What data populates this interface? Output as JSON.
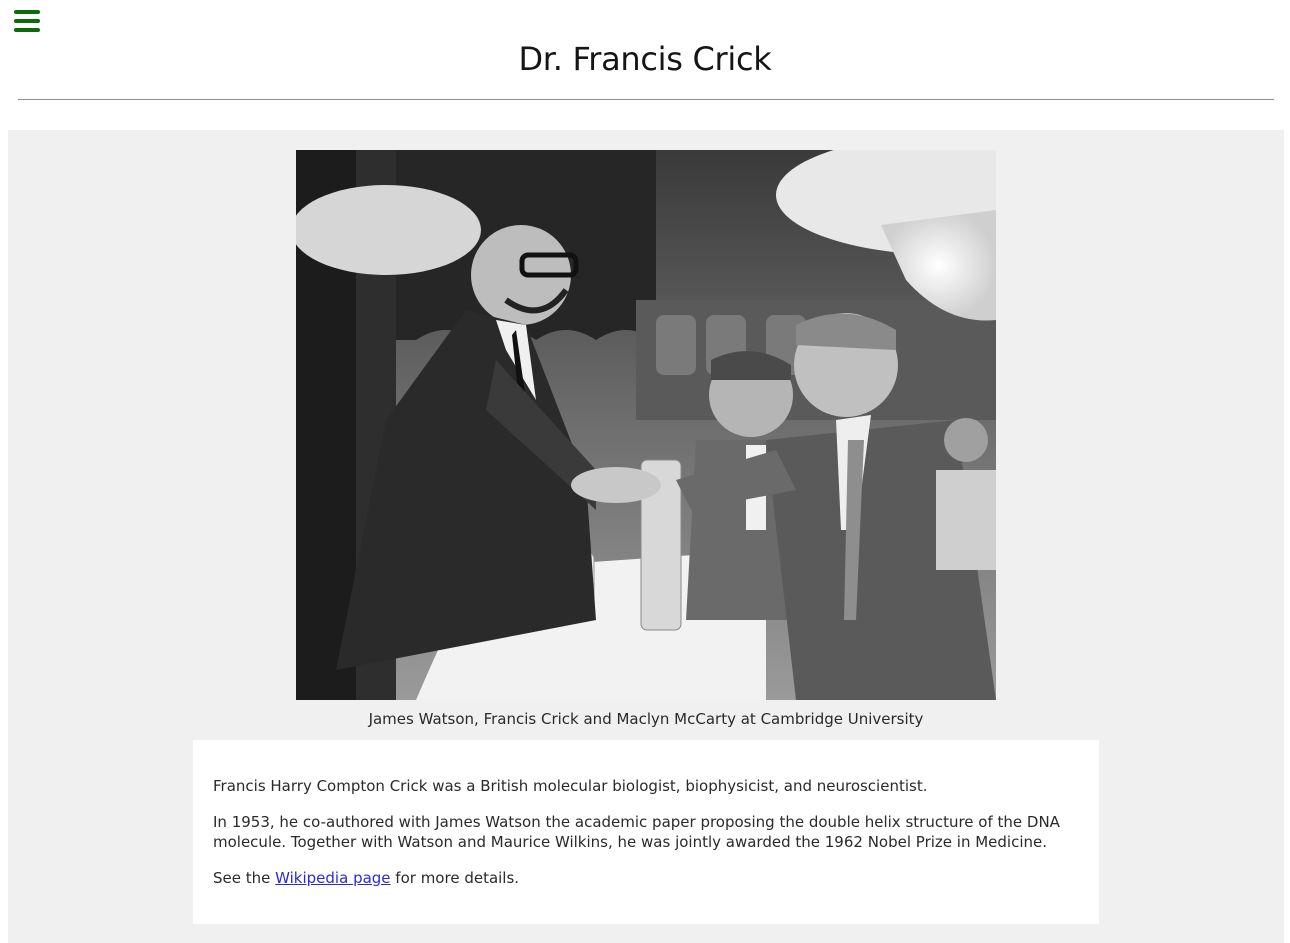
{
  "header": {
    "menu_icon": "hamburger-menu-icon",
    "title": "Dr. Francis Crick",
    "accent_color": "#0a6b0a"
  },
  "figure": {
    "caption": "James Watson, Francis Crick and Maclyn McCarty at Cambridge University"
  },
  "bio": {
    "paragraph_1": "Francis Harry Compton Crick was a British molecular biologist, biophysicist, and neuroscientist.",
    "paragraph_2": "In 1953, he co-authored with James Watson the academic paper proposing the double helix structure of the DNA molecule. Together with Watson and Maurice Wilkins, he was jointly awarded the 1962 Nobel Prize in Medicine.",
    "paragraph_3_prefix": "See the ",
    "link_text": "Wikipedia page",
    "paragraph_3_suffix": " for more details.",
    "link_color": "#2a2adb"
  }
}
